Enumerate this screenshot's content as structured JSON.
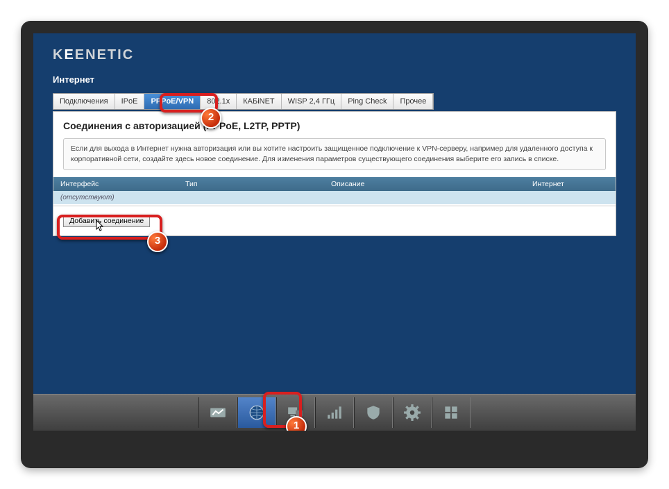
{
  "logo": {
    "prefix": "K",
    "mid": "E",
    "suffix": "ENETIC"
  },
  "section_title": "Интернет",
  "tabs": [
    {
      "label": "Подключения"
    },
    {
      "label": "IPoE"
    },
    {
      "label": "PPPoE/VPN"
    },
    {
      "label": "802.1x"
    },
    {
      "label": "КАБiNET"
    },
    {
      "label": "WISP 2,4 ГГц"
    },
    {
      "label": "Ping Check"
    },
    {
      "label": "Прочее"
    }
  ],
  "panel": {
    "title": "Соединения с авторизацией (PPPoE, L2TP, PPTP)",
    "description": "Если для выхода в Интернет нужна авторизация или вы хотите настроить защищенное подключение к VPN-серверу, например для удаленного доступа к корпоративной сети, создайте здесь новое соединение. Для изменения параметров существующего соединения выберите его запись в списке.",
    "columns": {
      "col1": "Интерфейс",
      "col2": "Тип",
      "col3": "Описание",
      "col4": "Интернет"
    },
    "empty_row": "(отсутствуют)",
    "add_button": "Добавить соединение"
  },
  "taskbar": [
    {
      "id": "stats",
      "icon": "chart"
    },
    {
      "id": "internet",
      "icon": "globe"
    },
    {
      "id": "lan",
      "icon": "devices"
    },
    {
      "id": "wifi",
      "icon": "signal"
    },
    {
      "id": "security",
      "icon": "shield"
    },
    {
      "id": "settings",
      "icon": "gear"
    },
    {
      "id": "apps",
      "icon": "grid"
    }
  ],
  "callouts": {
    "c1": "1",
    "c2": "2",
    "c3": "3"
  }
}
